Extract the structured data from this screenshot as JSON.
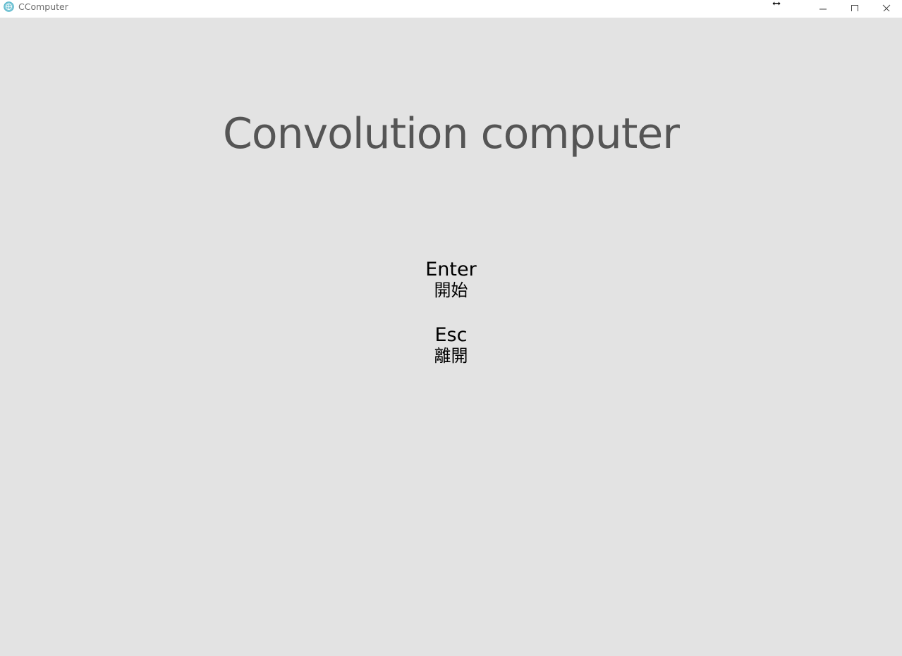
{
  "window": {
    "title": "CComputer",
    "app_icon": "globe-app-icon",
    "controls": {
      "minimize_icon": "minimize-icon",
      "maximize_icon": "maximize-icon",
      "close_icon": "close-icon"
    },
    "cursor_icon": "horizontal-resize-cursor-icon"
  },
  "main": {
    "title": "Convolution computer",
    "menu": [
      {
        "key": "Enter",
        "label": "開始"
      },
      {
        "key": "Esc",
        "label": "離開"
      }
    ]
  },
  "colors": {
    "background": "#e3e3e3",
    "titlebar": "#ffffff",
    "title_text": "#555555",
    "menu_text": "#000000",
    "icon_accent": "#4fb3c8"
  }
}
